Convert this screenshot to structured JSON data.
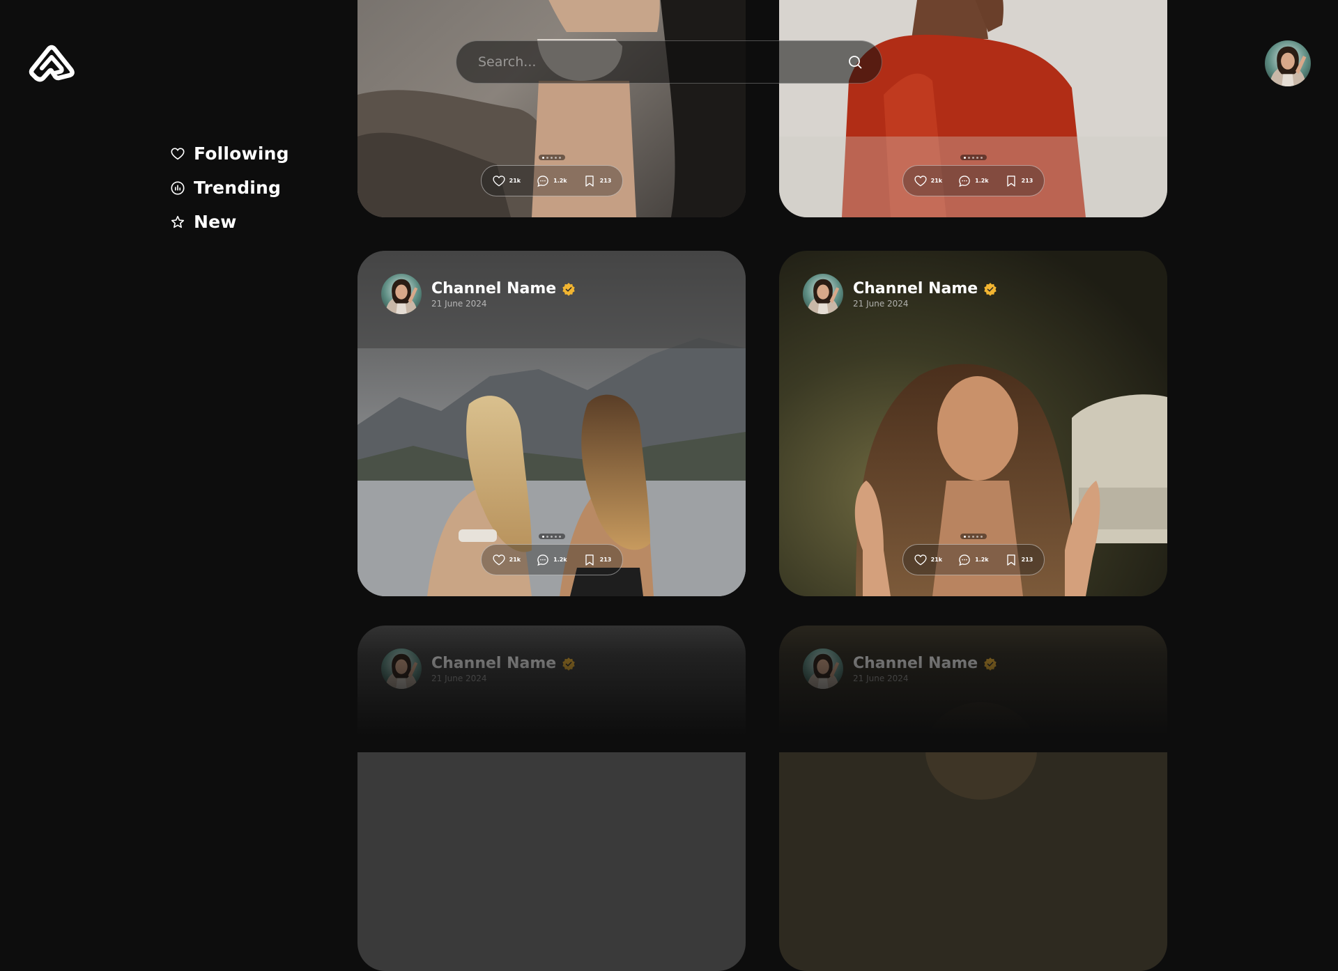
{
  "brand": {
    "logo_icon": "logo-mark-icon"
  },
  "search": {
    "placeholder": "Search..."
  },
  "nav": {
    "items": [
      {
        "label": "Following",
        "icon": "heart-icon"
      },
      {
        "label": "Trending",
        "icon": "chart-icon"
      },
      {
        "label": "New",
        "icon": "star-icon"
      }
    ]
  },
  "colors": {
    "background": "#0d0d0d",
    "verified": "#f2b531",
    "text": "#ffffff"
  },
  "posts": [
    {
      "likes": "21k",
      "comments": "1.2k",
      "saves": "213"
    },
    {
      "likes": "21k",
      "comments": "1.2k",
      "saves": "213"
    },
    {
      "channel": "Channel Name",
      "date": "21 June 2024",
      "likes": "21k",
      "comments": "1.2k",
      "saves": "213"
    },
    {
      "channel": "Channel Name",
      "date": "21 June 2024",
      "likes": "21k",
      "comments": "1.2k",
      "saves": "213"
    },
    {
      "channel": "Channel Name",
      "date": "21 June 2024"
    },
    {
      "channel": "Channel Name",
      "date": "21 June 2024"
    }
  ]
}
